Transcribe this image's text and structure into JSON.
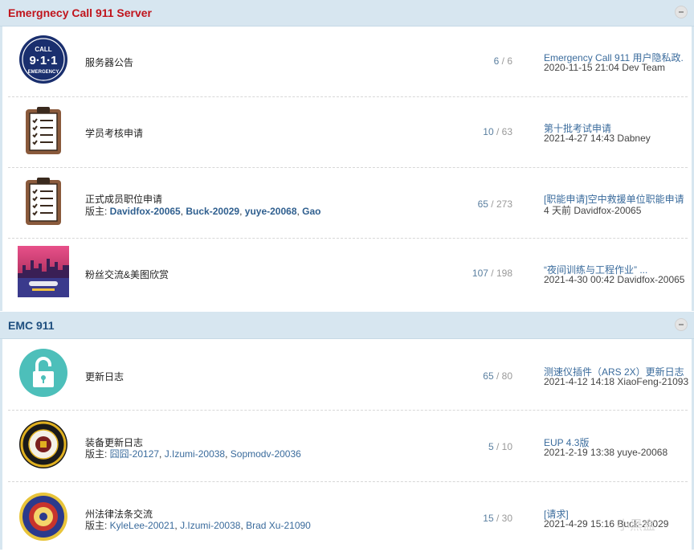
{
  "categories": [
    {
      "title": "Emergnecy Call 911 Server",
      "color": "#c0141c"
    },
    {
      "title": "EMC 911",
      "color": "#1f4f7f"
    }
  ],
  "forums": [
    {
      "icon": "emergency-911-badge-icon",
      "name": "服务器公告",
      "moderators": [],
      "moderators_label": "",
      "topics": "6",
      "posts": "6",
      "last_title": "Emergency Call 911 用户隐私政...",
      "last_meta": "2020-11-15 21:04 Dev Team"
    },
    {
      "icon": "clipboard-checklist-icon",
      "name": "学员考核申请",
      "moderators": [],
      "moderators_label": "",
      "topics": "10",
      "posts": "63",
      "last_title": "第十批考试申请",
      "last_meta": "2021-4-27 14:43 Dabney"
    },
    {
      "icon": "clipboard-checklist-icon",
      "name": "正式成员职位申请",
      "moderators_label": "版主: ",
      "moderators": [
        "Davidfox-20065",
        "Buck-20029",
        "yuye-20068",
        "Gao"
      ],
      "topics": "65",
      "posts": "273",
      "last_title": "[职能申请]空中救援单位职能申请 ...",
      "last_meta": "4 天前 Davidfox-20065"
    },
    {
      "icon": "fan-art-image-icon",
      "name": "粉丝交流&美图欣赏",
      "moderators": [],
      "moderators_label": "",
      "topics": "107",
      "posts": "198",
      "last_title": "“夜间训练与工程作业” ...",
      "last_meta": "2021-4-30 00:42 Davidfox-20065"
    },
    {
      "icon": "unlock-icon",
      "name": "更新日志",
      "moderators": [],
      "moderators_label": "",
      "topics": "65",
      "posts": "80",
      "last_title": "测速仪插件（ARS 2X）更新日志 ...",
      "last_meta": "2021-4-12 14:18 XiaoFeng-21093"
    },
    {
      "icon": "enforcement-seal-icon",
      "name": "装备更新日志",
      "moderators_label": "版主: ",
      "moderators": [
        "囧囧-20127",
        "J.Izumi-20038",
        "Sopmodv-20036"
      ],
      "topics": "5",
      "posts": "10",
      "last_title": "EUP 4.3版",
      "last_meta": "2021-2-19 13:38 yuye-20068"
    },
    {
      "icon": "justice-seal-icon",
      "name": "州法律法条交流",
      "moderators_label": "版主: ",
      "moderators": [
        "KyleLee-20021",
        "J.Izumi-20038",
        "Brad Xu-21090"
      ],
      "topics": "15",
      "posts": "30",
      "last_title": "[请求]",
      "last_meta": "2021-4-29 15:16 Buck-20029"
    }
  ],
  "watermark": "小黑盒"
}
